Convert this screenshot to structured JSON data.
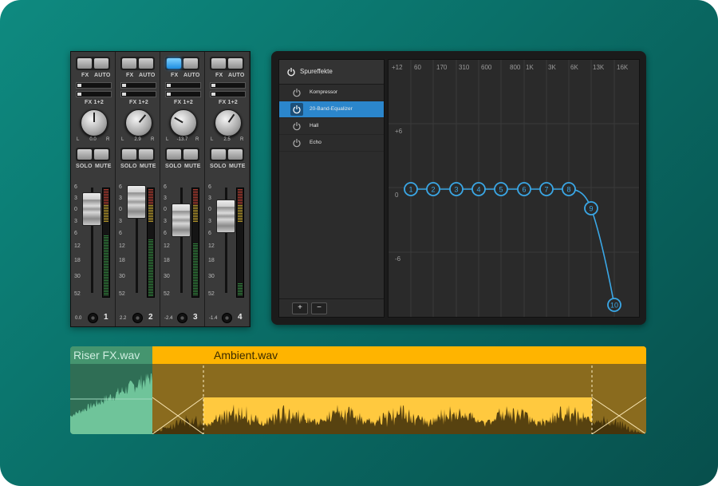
{
  "mixer": {
    "btn_fx": "FX",
    "btn_auto": "AUTO",
    "send_label": "FX 1+2",
    "btn_solo": "SOLO",
    "btn_mute": "MUTE",
    "pan_left": "L",
    "pan_right": "R",
    "scale": [
      "6",
      "3",
      "0",
      "3",
      "6",
      "12",
      "18",
      "30",
      "52"
    ],
    "channels": [
      {
        "pan": "0.0",
        "gain": "0.0",
        "number": "1",
        "fx_active": false
      },
      {
        "pan": "2.9",
        "gain": "2.2",
        "number": "2",
        "fx_active": false
      },
      {
        "pan": "-13.7",
        "gain": "-2.4",
        "number": "3",
        "fx_active": true
      },
      {
        "pan": "2.5",
        "gain": "-1.4",
        "number": "4",
        "fx_active": false
      }
    ]
  },
  "track_fx": {
    "title": "Spureffekte",
    "items": [
      {
        "name": "Kompressor",
        "selected": false
      },
      {
        "name": "20-Band-Equalizer",
        "selected": true
      },
      {
        "name": "Hall",
        "selected": false
      },
      {
        "name": "Echo",
        "selected": false
      }
    ],
    "add_label": "+",
    "remove_label": "−"
  },
  "equalizer": {
    "freq_labels": [
      "+12",
      "60",
      "170",
      "310",
      "600",
      "800",
      "1K",
      "3K",
      "6K",
      "13K",
      "16K"
    ],
    "db_labels": [
      "+6",
      "0",
      "-6"
    ],
    "band_labels": [
      "1",
      "2",
      "3",
      "4",
      "5",
      "6",
      "7",
      "8",
      "9",
      "10"
    ],
    "accent": "#3aa7e6"
  },
  "timeline": {
    "clip_a": {
      "name": "Riser FX.wav",
      "color": "#3d8a68"
    },
    "clip_b": {
      "name": "Ambient.wav",
      "color": "#ffc93f"
    }
  }
}
